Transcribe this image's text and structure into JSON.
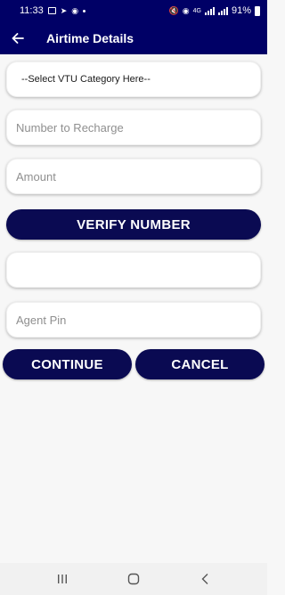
{
  "status_bar": {
    "time": "11:33",
    "network_label": "4G",
    "battery": "91%"
  },
  "app_bar": {
    "title": "Airtime Details"
  },
  "form": {
    "category_select": "--Select VTU Category Here--",
    "number_placeholder": "Number to Recharge",
    "amount_placeholder": "Amount",
    "verify_label": "VERIFY NUMBER",
    "result_value": "",
    "pin_placeholder": "Agent Pin",
    "continue_label": "CONTINUE",
    "cancel_label": "CANCEL"
  },
  "colors": {
    "primary": "#000066",
    "button": "#0a0a52",
    "background": "#f7f7f7"
  }
}
